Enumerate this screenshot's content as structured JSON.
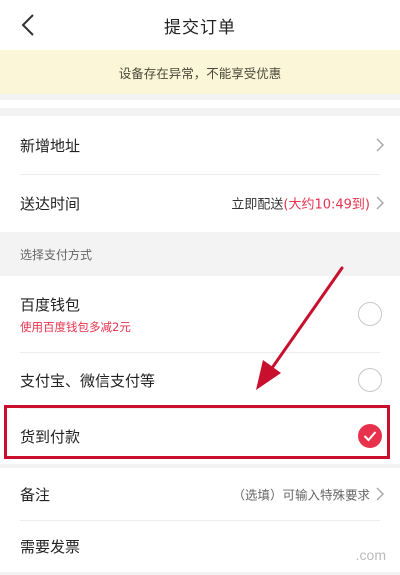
{
  "header": {
    "title": "提交订单"
  },
  "warning": {
    "text": "设备存在异常，不能享受优惠"
  },
  "address": {
    "label": "新增地址"
  },
  "delivery": {
    "label": "送达时间",
    "value_prefix": "立即配送",
    "value_highlight": "(大约10:49到)"
  },
  "payment": {
    "section_title": "选择支付方式",
    "options": [
      {
        "name": "百度钱包",
        "sub": "使用百度钱包多减2元",
        "selected": false
      },
      {
        "name": "支付宝、微信支付等",
        "selected": false
      },
      {
        "name": "货到付款",
        "selected": true
      }
    ]
  },
  "remark": {
    "label": "备注",
    "placeholder": "（选填）可输入特殊要求"
  },
  "invoice": {
    "label": "需要发票"
  },
  "watermark": {
    "text": ".com"
  },
  "colors": {
    "accent": "#e8324d",
    "annotation": "#c8102e",
    "warning_bg": "#fbf6d8"
  }
}
